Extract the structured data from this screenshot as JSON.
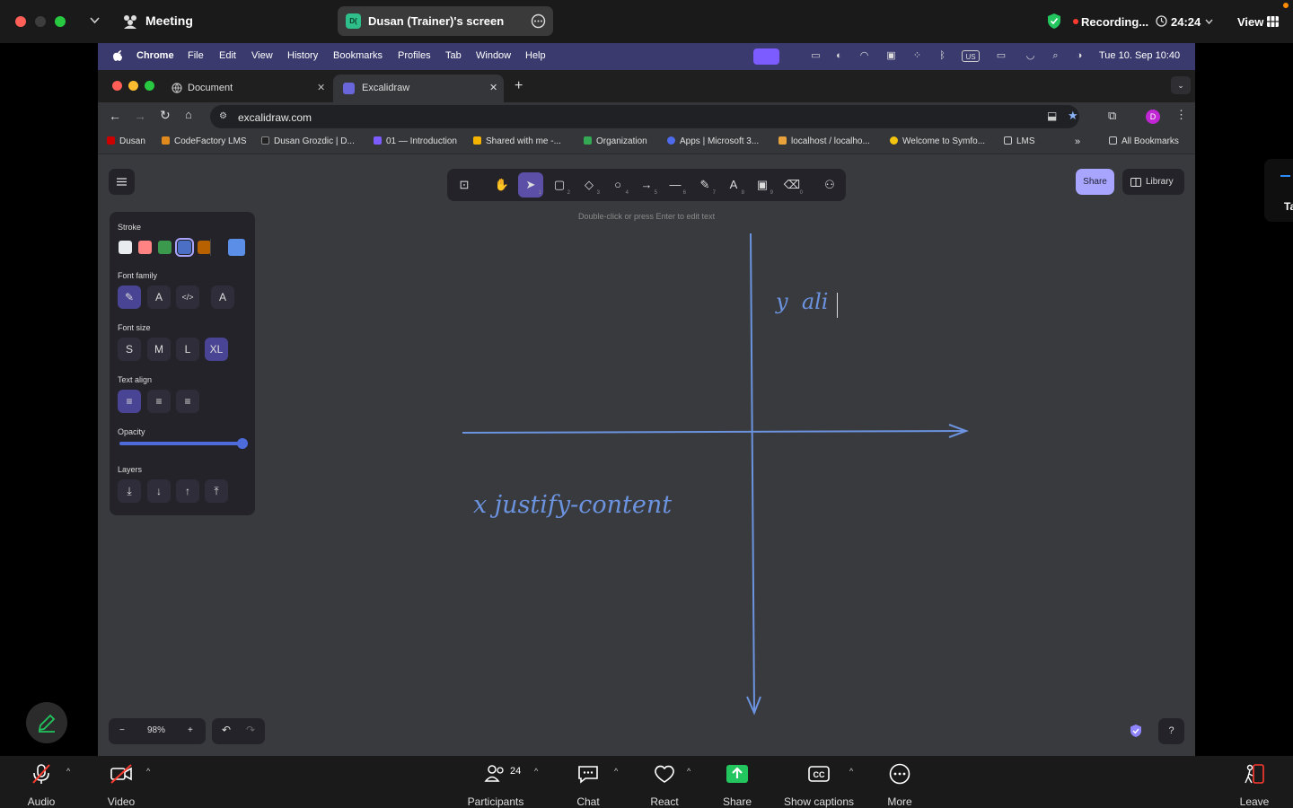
{
  "zoom": {
    "meeting_label": "Meeting",
    "share_title": "Dusan (Trainer)'s screen",
    "share_initials": "D(",
    "recording_label": "Recording...",
    "timer": "24:24",
    "view_label": "View",
    "side_peek_text": "Ta",
    "bottom": {
      "audio": "Audio",
      "video": "Video",
      "participants": "Participants",
      "participants_count": "24",
      "chat": "Chat",
      "react": "React",
      "share": "Share",
      "captions": "Show captions",
      "more": "More",
      "leave": "Leave"
    }
  },
  "macos": {
    "app": "Chrome",
    "menus": [
      "File",
      "Edit",
      "View",
      "History",
      "Bookmarks",
      "Profiles",
      "Tab",
      "Window",
      "Help"
    ],
    "clock": "Tue 10. Sep  10:40"
  },
  "chrome": {
    "tabs": [
      {
        "title": "Document",
        "active": false
      },
      {
        "title": "Excalidraw",
        "active": true
      }
    ],
    "url": "excalidraw.com",
    "profile_initial": "D",
    "bookmarks": [
      "Dusan",
      "CodeFactory LMS",
      "Dusan Grozdic | D...",
      "01 — Introduction",
      "Shared with me -...",
      "Organization",
      "Apps | Microsoft 3...",
      "localhost / localho...",
      "Welcome to Symfo...",
      "LMS"
    ],
    "all_bookmarks": "All Bookmarks"
  },
  "excalidraw": {
    "hint": "Double-click or press Enter to edit text",
    "share_label": "Share",
    "library_label": "Library",
    "tools": [
      {
        "icon": "lock-icon",
        "key": ""
      },
      {
        "icon": "hand-icon",
        "key": ""
      },
      {
        "icon": "selection-icon",
        "key": "1"
      },
      {
        "icon": "rectangle-icon",
        "key": "2"
      },
      {
        "icon": "diamond-icon",
        "key": "3"
      },
      {
        "icon": "ellipse-icon",
        "key": "4"
      },
      {
        "icon": "arrow-icon",
        "key": "5"
      },
      {
        "icon": "line-icon",
        "key": "6"
      },
      {
        "icon": "draw-icon",
        "key": "7"
      },
      {
        "icon": "text-icon",
        "key": "8"
      },
      {
        "icon": "image-icon",
        "key": "9"
      },
      {
        "icon": "eraser-icon",
        "key": "0"
      },
      {
        "icon": "more-tools-icon",
        "key": ""
      }
    ],
    "props": {
      "stroke_label": "Stroke",
      "stroke_colors": [
        "#e9ecef",
        "#ff8383",
        "#3a994c",
        "#4a6fc4",
        "#b76100"
      ],
      "current_color": "#5b8ee6",
      "font_family_label": "Font family",
      "font_size_label": "Font size",
      "font_sizes": [
        "S",
        "M",
        "L",
        "XL"
      ],
      "text_align_label": "Text align",
      "opacity_label": "Opacity",
      "opacity_value": 100,
      "layers_label": "Layers"
    },
    "zoom_level": "98%",
    "canvas_text": {
      "x_label": "x  justify-content",
      "y_label": "y  ali"
    }
  }
}
